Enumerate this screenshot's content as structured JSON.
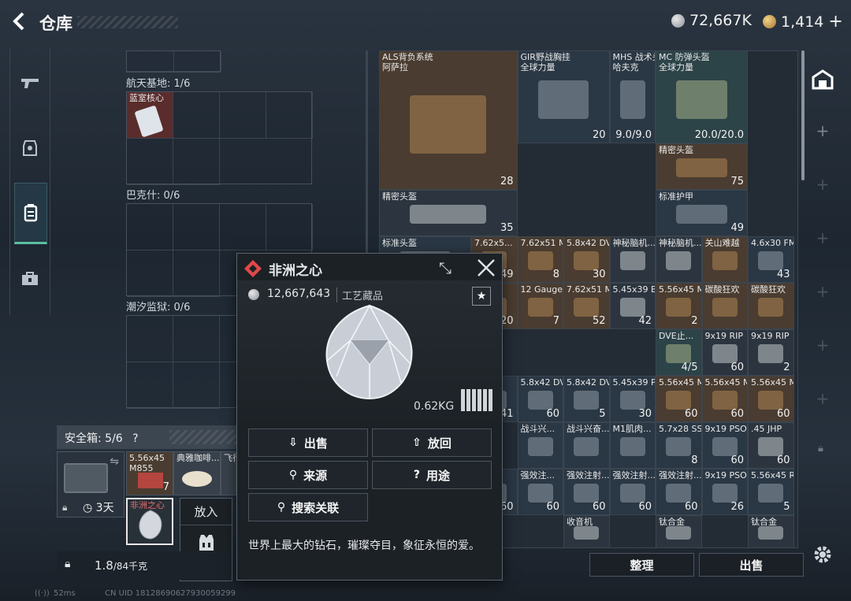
{
  "header": {
    "back_icon": "back-arrow-icon",
    "title": "仓库",
    "currency1": "72,667K",
    "currency2": "1,414",
    "plus": "+"
  },
  "storage_sections": [
    {
      "label": "航天基地: 1/6",
      "item": "蓝室核心"
    },
    {
      "label": "巴克什: 0/6"
    },
    {
      "label": "潮汐监狱: 0/6"
    }
  ],
  "safe_box": {
    "label": "安全箱: 5/6",
    "help": "?",
    "timer": "3天",
    "slot_item": "5.56x45 M855",
    "slot_count": "7",
    "slot2": "典雅咖啡...",
    "slot3": "飞行",
    "selected_item": "非洲之心"
  },
  "bottom": {
    "weight": "1.8",
    "weight_unit": "/84千克",
    "sort": "整理",
    "sell": "出售"
  },
  "put_in_popup": {
    "put_in": "放入",
    "vest": "胸挂"
  },
  "grid_items": [
    {
      "name": "ALS背负系统",
      "sub": "阿萨拉",
      "count": "28"
    },
    {
      "name": "GIR野战胸挂",
      "sub": "全球力量",
      "count": "20"
    },
    {
      "name": "MHS 战术头盔",
      "sub": "哈夫克",
      "count": "9.0/9.0"
    },
    {
      "name": "MC 防弹头盔",
      "sub": "全球力量",
      "count": "20.0/20.0"
    },
    {
      "name": "精密头盔",
      "count": "75"
    },
    {
      "name": "精密头盔",
      "count": "35"
    },
    {
      "name": "标准护甲",
      "count": "49"
    },
    {
      "name": "标准头盔",
      "count": ""
    },
    {
      "name": "7.62x5...",
      "count": "49"
    },
    {
      "name": "7.62x51 M6...",
      "count": "8"
    },
    {
      "name": "5.8x42 DVC...",
      "count": "30"
    },
    {
      "name": "神秘脑机...",
      "count": ""
    },
    {
      "name": "神秘脑机...",
      "count": ""
    },
    {
      "name": "关山难越",
      "count": ""
    },
    {
      "name": "4.6x30 FMJ",
      "count": "43"
    },
    {
      "name": "...uge",
      "count": "20"
    },
    {
      "name": "12 Gauge A...",
      "count": "7"
    },
    {
      "name": "7.62x51 M80",
      "count": "52"
    },
    {
      "name": "5.45x39 BT",
      "count": "42"
    },
    {
      "name": "5.56x45 M855A1",
      "count": "2"
    },
    {
      "name": "碳酸狂欢",
      "count": ""
    },
    {
      "name": "碳酸狂欢",
      "count": ""
    },
    {
      "name": "DVE止...",
      "count": "4/5"
    },
    {
      "name": "9x19 RIP",
      "count": "60"
    },
    {
      "name": "9x19 RIP",
      "count": "2"
    },
    {
      "name": "",
      "count": "41"
    },
    {
      "name": "5.8x42 DVC88",
      "count": "60"
    },
    {
      "name": "5.8x42 DVC88",
      "count": "5"
    },
    {
      "name": "5.45x39 PP",
      "count": "30"
    },
    {
      "name": "5.56x45 M855",
      "count": "60"
    },
    {
      "name": "5.56x45 M855",
      "count": "60"
    },
    {
      "name": "5.56x45 M855",
      "count": "60"
    },
    {
      "name": "战斗兴...",
      "count": ""
    },
    {
      "name": "战斗兴奋...",
      "count": ""
    },
    {
      "name": "M1肌肉...",
      "count": ""
    },
    {
      "name": "5.7x28 SS190SR",
      "count": "8"
    },
    {
      "name": "9x19 PSO",
      "count": "60"
    },
    {
      "name": ".45 JHP",
      "count": "60"
    },
    {
      "name": "",
      "count": "60"
    },
    {
      "name": "强效注...",
      "count": "60"
    },
    {
      "name": "强效注射...",
      "count": "60"
    },
    {
      "name": "强效注射...",
      "count": "60"
    },
    {
      "name": "强效注射...",
      "count": "60"
    },
    {
      "name": "9x19 PSO",
      "count": "26"
    },
    {
      "name": "5.56x45 RRLP",
      "count": "5"
    },
    {
      "name": "收音机",
      "count": ""
    },
    {
      "name": "钛合金",
      "count": ""
    },
    {
      "name": "钛合金",
      "count": ""
    }
  ],
  "popup": {
    "title": "非洲之心",
    "price": "12,667,643",
    "category": "工艺藏品",
    "weight": "0.62KG",
    "buttons": {
      "sell": "出售",
      "return": "放回",
      "source": "来源",
      "usage": "用途",
      "search": "搜索关联"
    },
    "description": "世界上最大的钻石，璀璨夺目，象征永恒的爱。"
  },
  "footer": {
    "ping": "52ms",
    "uid": "CN UID 18128690627930059299"
  },
  "colors": {
    "accent": "#e04848",
    "active_tab": "#5bbfa0"
  }
}
